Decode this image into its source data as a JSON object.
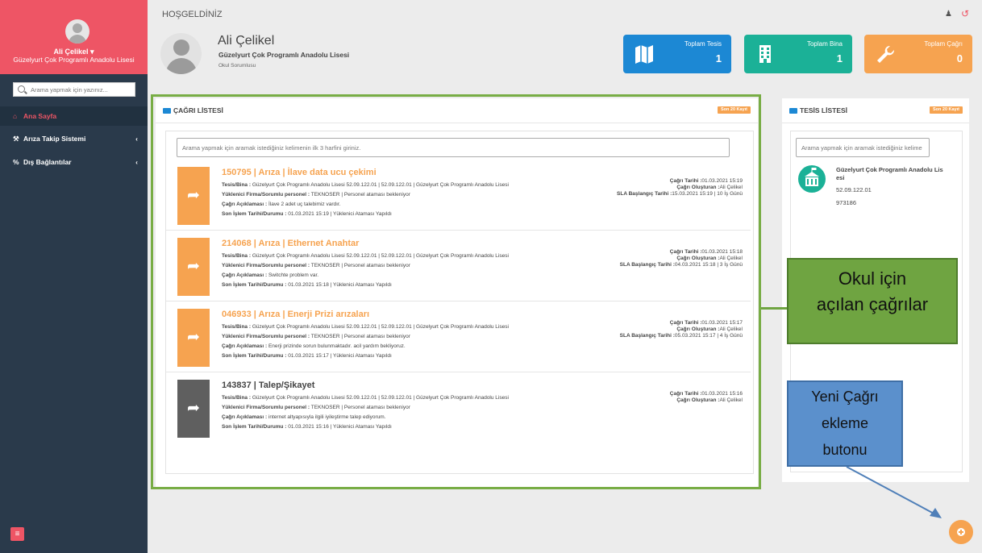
{
  "sidebar": {
    "user_name": "Ali Çelikel ▾",
    "school": "Güzelyurt Çok Programlı Anadolu Lisesi",
    "search_placeholder": "Arama yapmak için yazınız...",
    "nav": [
      {
        "label": "Ana Sayfa",
        "icon": "home-icon"
      },
      {
        "label": "Arıza Takip Sistemi",
        "icon": "wrench-icon"
      },
      {
        "label": "Dış Bağlantılar",
        "icon": "link-icon"
      }
    ]
  },
  "header": {
    "welcome": "HOŞGELDİNİZ",
    "user_name": "Ali Çelikel",
    "school": "Güzelyurt Çok Programlı Anadolu Lisesi",
    "role": "Okul Sorumlusu"
  },
  "stats": [
    {
      "label": "Toplam Tesis",
      "value": "1",
      "color": "#1c88d4",
      "icon": "map-icon"
    },
    {
      "label": "Toplam Bina",
      "value": "1",
      "color": "#1bb197",
      "icon": "building-icon"
    },
    {
      "label": "Toplam Çağrı",
      "value": "0",
      "color": "#f6a350",
      "icon": "wrench-icon"
    }
  ],
  "call_panel": {
    "title": "ÇAĞRI LİSTESİ",
    "badge": "Son 20 Kayıt",
    "search_placeholder": "Arama yapmak için aramak istediğiniz kelimenin ilk 3 harfini giriniz.",
    "labels": {
      "tesis_bina": "Tesis/Bina :",
      "firma": "Yüklenici Firma/Sorumlu personel :",
      "aciklama": "Çağrı Açıklaması :",
      "son_islem": "Son İşlem Tarihi/Durumu :",
      "cagri_tarihi": "Çağrı Tarihi :",
      "olusturan": "Çağrı Oluşturan :",
      "sla": "SLA Başlangıç Tarihi :"
    },
    "items": [
      {
        "title": "150795 | Arıza | İlave data ucu çekimi",
        "tesis": "Güzelyurt Çok Programlı Anadolu Lisesi 52.09.122.01 | 52.09.122.01 | Güzelyurt Çok Programlı Anadolu Lisesi",
        "firma": "TEKNOSER | Personel ataması bekleniyor",
        "aciklama": "İlave 2 adet uç talebimiz vardır.",
        "son_islem": "01.03.2021 15:19 | Yüklenici Ataması Yapıldı",
        "tarih": "01.03.2021 15:19",
        "olusturan": "Ali Çelikel",
        "sla": "15.03.2021 15:19 | 10 İş Günü"
      },
      {
        "title": "214068 | Arıza | Ethernet Anahtar",
        "tesis": "Güzelyurt Çok Programlı Anadolu Lisesi 52.09.122.01 | 52.09.122.01 | Güzelyurt Çok Programlı Anadolu Lisesi",
        "firma": "TEKNOSER | Personel ataması bekleniyor",
        "aciklama": "Switchte problem var.",
        "son_islem": "01.03.2021 15:18 | Yüklenici Ataması Yapıldı",
        "tarih": "01.03.2021 15:18",
        "olusturan": "Ali Çelikel",
        "sla": "04.03.2021 15:18 | 3 İş Günü"
      },
      {
        "title": "046933 | Arıza | Enerji Prizi arızaları",
        "tesis": "Güzelyurt Çok Programlı Anadolu Lisesi 52.09.122.01 | 52.09.122.01 | Güzelyurt Çok Programlı Anadolu Lisesi",
        "firma": "TEKNOSER | Personel ataması bekleniyor",
        "aciklama": "Enerji prizinde sorun bulunmaktadır. acil yardım bekliyoruz.",
        "son_islem": "01.03.2021 15:17 | Yüklenici Ataması Yapıldı",
        "tarih": "01.03.2021 15:17",
        "olusturan": "Ali Çelikel",
        "sla": "05.03.2021 15:17 | 4 İş Günü"
      },
      {
        "title": "143837 | Talep/Şikayet",
        "tesis": "Güzelyurt Çok Programlı Anadolu Lisesi 52.09.122.01 | 52.09.122.01 | Güzelyurt Çok Programlı Anadolu Lisesi",
        "firma": "TEKNOSER | Personel ataması bekleniyor",
        "aciklama": "internet altyapısıyla ilgili iyileştirme talep ediyorum.",
        "son_islem": "01.03.2021 15:16 | Yüklenici Ataması Yapıldı",
        "tarih": "01.03.2021 15:16",
        "olusturan": "Ali Çelikel",
        "sla": ""
      }
    ]
  },
  "facility_panel": {
    "title": "TESİS LİSTESİ",
    "badge": "Son 20 Kayıt",
    "search_placeholder": "Arama yapmak için aramak istediğiniz kelime",
    "item": {
      "name": "Güzelyurt Çok Programlı Anadolu Lis esi",
      "code": "52.09.122.01",
      "number": "973186"
    }
  },
  "annotations": {
    "green_line1": "Okul için",
    "green_line2": "açılan çağrılar",
    "blue_line1": "Yeni Çağrı",
    "blue_line2": "ekleme",
    "blue_line3": "butonu"
  },
  "colors": {
    "accent_red": "#ee5565",
    "sidebar_bg": "#2a3a4b",
    "orange": "#f6a350",
    "blue": "#1c88d4",
    "teal": "#1bb197"
  }
}
